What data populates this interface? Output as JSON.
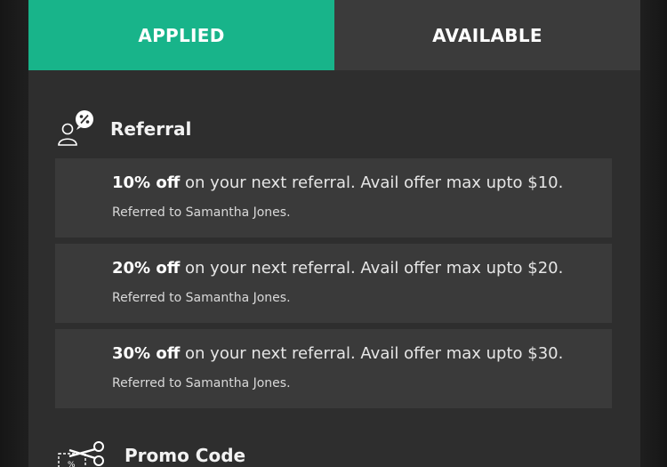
{
  "tabs": [
    {
      "label": "APPLIED",
      "active": true
    },
    {
      "label": "AVAILABLE",
      "active": false
    }
  ],
  "colors": {
    "accent": "#18b48a",
    "tab_inactive": "#3b3b3b",
    "panel": "#2e2e2e",
    "card": "#3a3a3a"
  },
  "referral": {
    "title": "Referral",
    "icon": "referral-percent-icon",
    "offers": [
      {
        "percent": "10% off",
        "text": " on your next referral. Avail offer max upto $10.",
        "note": "Referred to Samantha Jones."
      },
      {
        "percent": "20% off",
        "text": " on your next referral. Avail offer max upto $20.",
        "note": "Referred to Samantha Jones."
      },
      {
        "percent": "30% off",
        "text": " on your next referral. Avail offer max upto $30.",
        "note": "Referred to Samantha Jones."
      }
    ]
  },
  "promo": {
    "title": "Promo Code",
    "icon": "scissors-coupon-icon"
  }
}
